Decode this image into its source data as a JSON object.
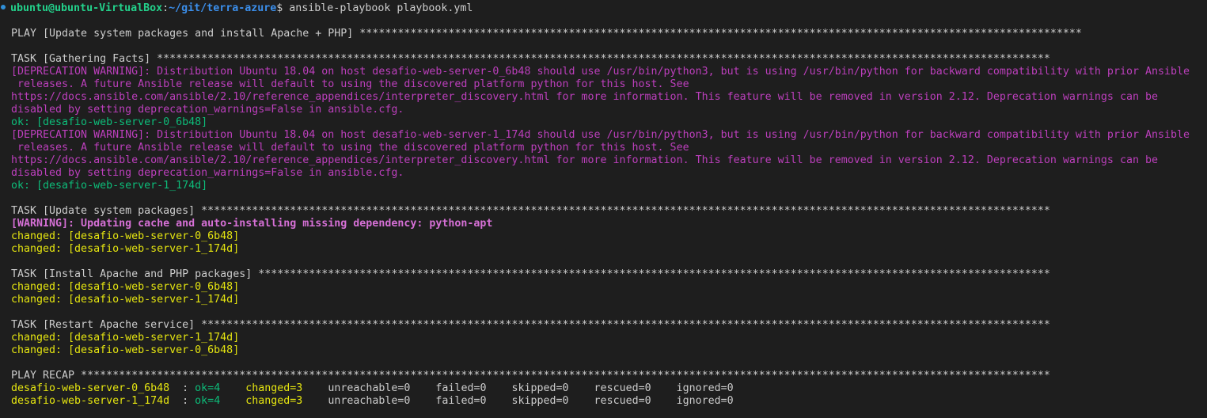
{
  "prompt": {
    "user_host": "ubuntu@ubuntu-VirtualBox",
    "colon": ":",
    "path": "~/git/terra-azure",
    "dollar": "$",
    "command": " ansible-playbook playbook.yml"
  },
  "lines": {
    "play_header": "PLAY [Update system packages and install Apache + PHP] ******************************************************************************************************************",
    "task_facts": "TASK [Gathering Facts] *********************************************************************************************************************************************",
    "dep1_a": "[DEPRECATION WARNING]: Distribution Ubuntu 18.04 on host desafio-web-server-0_6b48 should use /usr/bin/python3, but is using /usr/bin/python for backward compatibility with prior Ansible",
    "dep1_b": " releases. A future Ansible release will default to using the discovered platform python for this host. See",
    "dep1_c": "https://docs.ansible.com/ansible/2.10/reference_appendices/interpreter_discovery.html for more information. This feature will be removed in version 2.12. Deprecation warnings can be",
    "dep1_d": "disabled by setting deprecation_warnings=False in ansible.cfg.",
    "ok1": "ok: [desafio-web-server-0_6b48]",
    "dep2_a": "[DEPRECATION WARNING]: Distribution Ubuntu 18.04 on host desafio-web-server-1_174d should use /usr/bin/python3, but is using /usr/bin/python for backward compatibility with prior Ansible",
    "dep2_b": " releases. A future Ansible release will default to using the discovered platform python for this host. See",
    "dep2_c": "https://docs.ansible.com/ansible/2.10/reference_appendices/interpreter_discovery.html for more information. This feature will be removed in version 2.12. Deprecation warnings can be",
    "dep2_d": "disabled by setting deprecation_warnings=False in ansible.cfg.",
    "ok2": "ok: [desafio-web-server-1_174d]",
    "task_update": "TASK [Update system packages] **************************************************************************************************************************************",
    "warn_apt": "[WARNING]: Updating cache and auto-installing missing dependency: python-apt",
    "chg_u1": "changed: [desafio-web-server-0_6b48]",
    "chg_u2": "changed: [desafio-web-server-1_174d]",
    "task_install": "TASK [Install Apache and PHP packages] *****************************************************************************************************************************",
    "chg_i1": "changed: [desafio-web-server-0_6b48]",
    "chg_i2": "changed: [desafio-web-server-1_174d]",
    "task_restart": "TASK [Restart Apache service] **************************************************************************************************************************************",
    "chg_r1": "changed: [desafio-web-server-1_174d]",
    "chg_r2": "changed: [desafio-web-server-0_6b48]",
    "recap_header": "PLAY RECAP *********************************************************************************************************************************************************"
  },
  "recap": [
    {
      "host": "desafio-web-server-0_6b48",
      "sep": "  : ",
      "ok": "ok=4",
      "changed": "changed=3",
      "rest": "unreachable=0    failed=0    skipped=0    rescued=0    ignored=0"
    },
    {
      "host": "desafio-web-server-1_174d",
      "sep": "  : ",
      "ok": "ok=4",
      "changed": "changed=3",
      "rest": "unreachable=0    failed=0    skipped=0    rescued=0    ignored=0"
    }
  ],
  "colors": {
    "background": "#1e1e1e",
    "text": "#cccccc",
    "user_host": "#23d18b",
    "path": "#3b8eea",
    "deprecation": "#bc3fbc",
    "ok": "#0dbc79",
    "changed": "#e5e510"
  },
  "icons": {
    "prompt_marker": "circle-dot-icon"
  }
}
